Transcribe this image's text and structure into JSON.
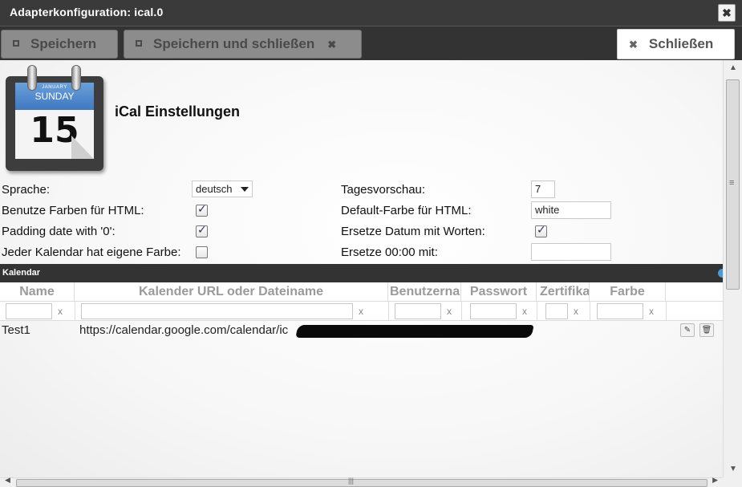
{
  "window": {
    "title": "Adapterkonfiguration: ical.0",
    "close_glyph": "✖"
  },
  "toolbar": {
    "save_label": "Speichern",
    "save_close_label": "Speichern und schließen",
    "close_label": "Schließen",
    "x_glyph": "✖"
  },
  "calendar_icon": {
    "month": "JANUARY",
    "weekday": "SUNDAY",
    "day": "15"
  },
  "heading": "iCal Einstellungen",
  "settings": {
    "sprache_label": "Sprache:",
    "sprache_value": "deutsch",
    "farben_html_label": "Benutze Farben für HTML:",
    "farben_html_checked": true,
    "padding_label": "Padding date with '0':",
    "padding_checked": true,
    "eigene_farbe_label": "Jeder Kalendar hat eigene Farbe:",
    "eigene_farbe_checked": false,
    "tagesvorschau_label": "Tagesvorschau:",
    "tagesvorschau_value": "7",
    "default_farbe_label": "Default-Farbe für HTML:",
    "default_farbe_value": "white",
    "datum_worten_label": "Ersetze Datum mit Worten:",
    "datum_worten_checked": true,
    "ersetze_0000_label": "Ersetze 00:00 mit:",
    "ersetze_0000_value": ""
  },
  "grid": {
    "title": "Kalendar",
    "columns": [
      "Name",
      "Kalender URL oder Dateiname",
      "Benutzername",
      "Passwort",
      "Zertifikat",
      "Farbe"
    ],
    "filter_clear": "x",
    "rows": [
      {
        "name": "Test1",
        "url": "https://calendar.google.com/calendar/ic"
      }
    ],
    "edit_icon": "✎",
    "delete_icon": "🗑"
  },
  "scrollbars": {
    "up": "▲",
    "down": "▼",
    "left": "◀",
    "right": "▶"
  }
}
